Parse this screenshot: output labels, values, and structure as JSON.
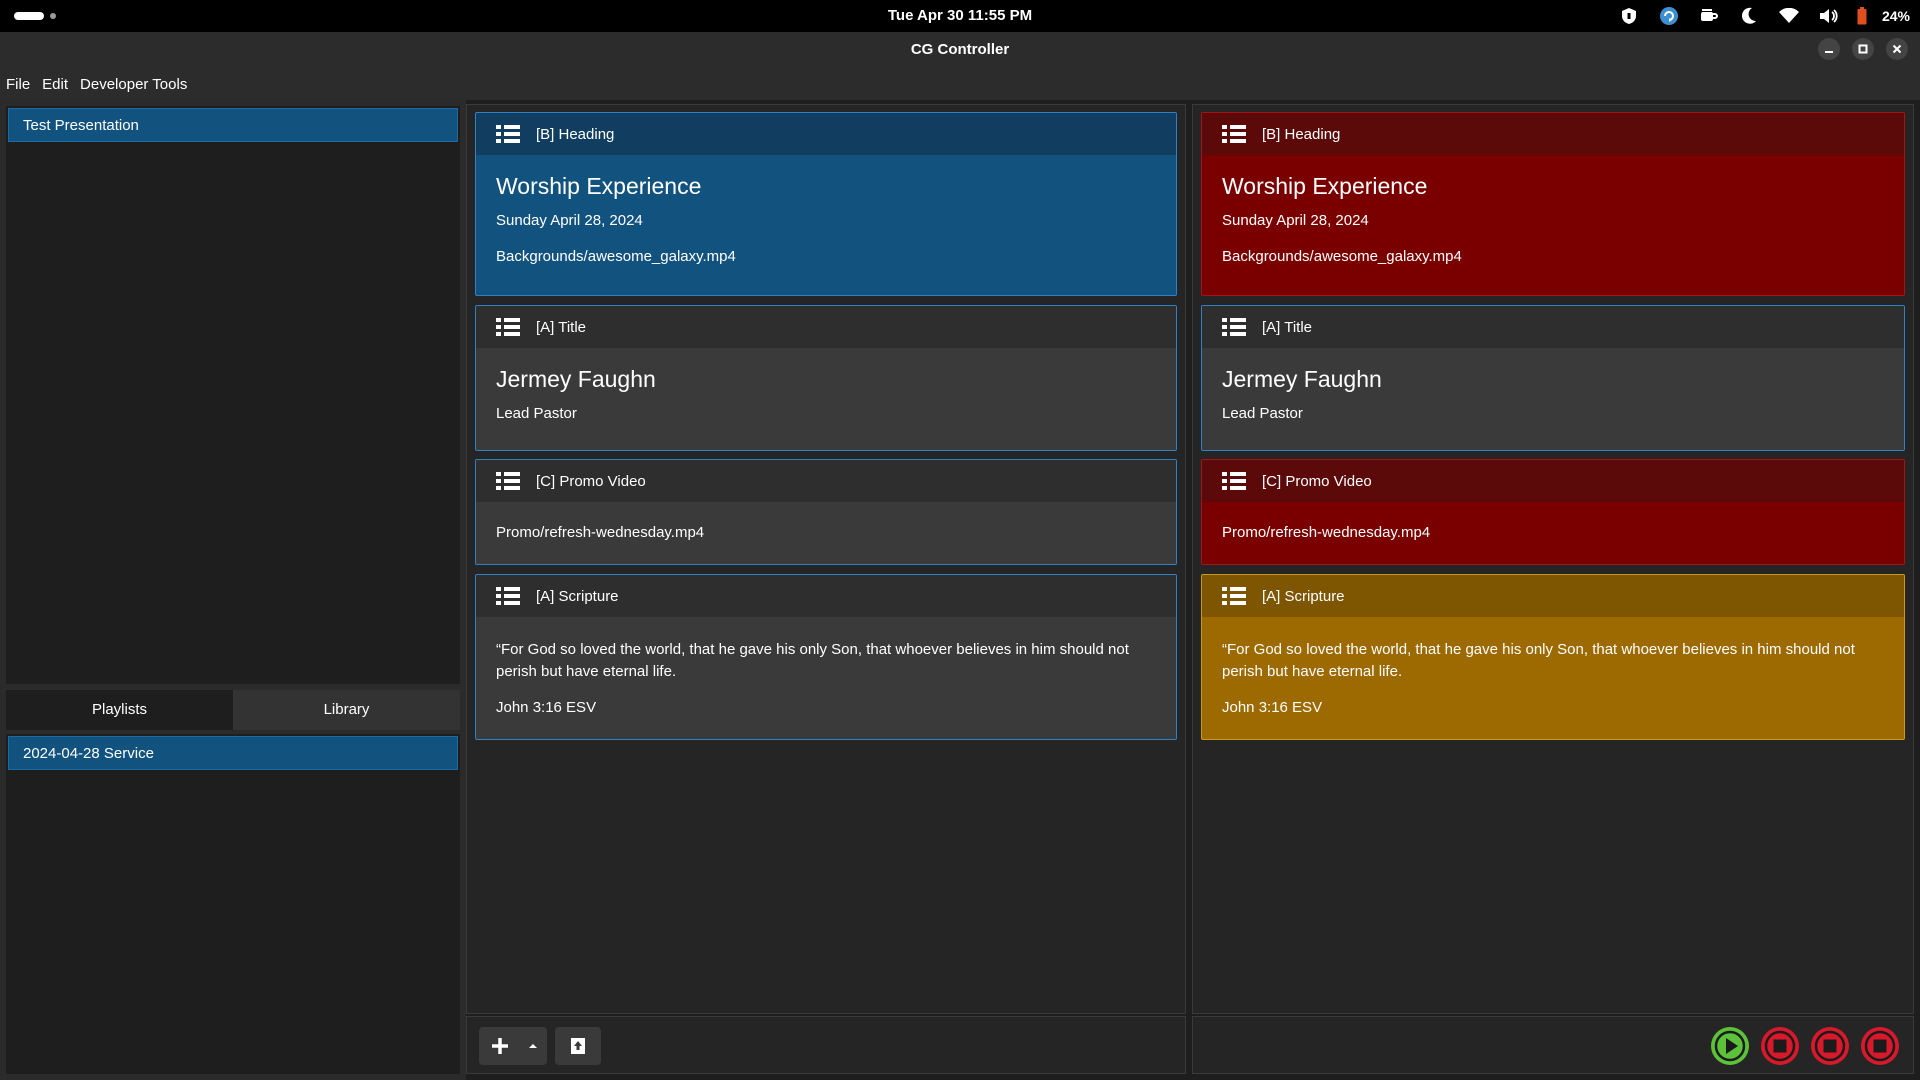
{
  "system_bar": {
    "datetime": "Tue Apr 30  11:55 PM",
    "battery": "24%",
    "tray_icons": [
      "shield-icon",
      "update-icon",
      "coffee-icon",
      "night-light-icon",
      "wifi-icon",
      "volume-icon",
      "battery-icon"
    ]
  },
  "window": {
    "title": "CG Controller"
  },
  "menu": {
    "file": "File",
    "edit": "Edit",
    "developer_tools": "Developer Tools"
  },
  "sidebar": {
    "presentations": [
      "Test Presentation"
    ],
    "tabs": {
      "playlists": "Playlists",
      "library": "Library"
    },
    "playlists": [
      "2024-04-28 Service"
    ]
  },
  "preview": {
    "cards": [
      {
        "header": "[B]  Heading",
        "title": "Worship Experience",
        "lines": [
          "Sunday April 28, 2024",
          "Backgrounds/awesome_galaxy.mp4"
        ]
      },
      {
        "header": "[A]  Title",
        "title": "Jermey Faughn",
        "lines": [
          "Lead Pastor"
        ]
      },
      {
        "header": "[C]  Promo Video",
        "lines": [
          "Promo/refresh-wednesday.mp4"
        ]
      },
      {
        "header": "[A]  Scripture",
        "lines": [
          "“For God so loved the world, that he gave his only Son, that whoever believes in him should not perish but have eternal life.",
          "John 3:16 ESV"
        ]
      }
    ]
  },
  "program": {
    "cards": [
      {
        "header": "[B]  Heading",
        "title": "Worship Experience",
        "lines": [
          "Sunday April 28, 2024",
          "Backgrounds/awesome_galaxy.mp4"
        ]
      },
      {
        "header": "[A]  Title",
        "title": "Jermey Faughn",
        "lines": [
          "Lead Pastor"
        ]
      },
      {
        "header": "[C]  Promo Video",
        "lines": [
          "Promo/refresh-wednesday.mp4"
        ]
      },
      {
        "header": "[A]  Scripture",
        "lines": [
          "“For God so loved the world, that he gave his only Son, that whoever believes in him should not perish but have eternal life.",
          "John 3:16 ESV"
        ]
      }
    ]
  },
  "colors": {
    "selected_blue": "#12527f",
    "live_red": "#7a0000",
    "cued_gold": "#9c6a00",
    "play_green": "#5cc23a",
    "stop_red": "#d8192b"
  },
  "controls": {
    "icons": [
      "play-icon",
      "stop-icon",
      "stop-icon",
      "stop-icon"
    ]
  }
}
